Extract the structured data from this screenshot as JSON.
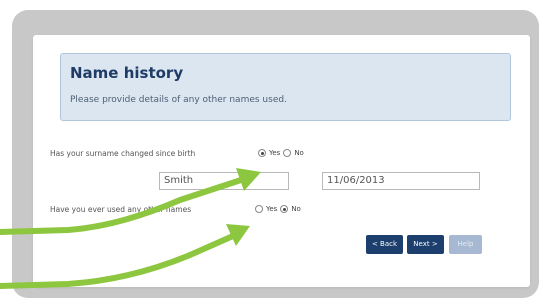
{
  "panel": {
    "title": "Name history",
    "description": "Please provide details of any other names used."
  },
  "question1": {
    "label": "Has your surname changed since birth",
    "options": [
      "Yes",
      "No"
    ],
    "selected": "Yes"
  },
  "surname_field": {
    "value": "Smith"
  },
  "date_field": {
    "value": "11/06/2013"
  },
  "question2": {
    "label": "Have you ever used any other names",
    "options": [
      "Yes",
      "No"
    ],
    "selected": "No"
  },
  "buttons": {
    "back": "< Back",
    "next": "Next >",
    "help": "Help"
  },
  "colors": {
    "arrow": "#8dc63f",
    "panel_bg": "#dbe6f1",
    "title": "#1f3c67",
    "button": "#1c3f6e",
    "button_disabled": "#a6b8d2"
  },
  "icons": [
    "arrow-annotation-icon",
    "arrow-annotation-icon"
  ]
}
